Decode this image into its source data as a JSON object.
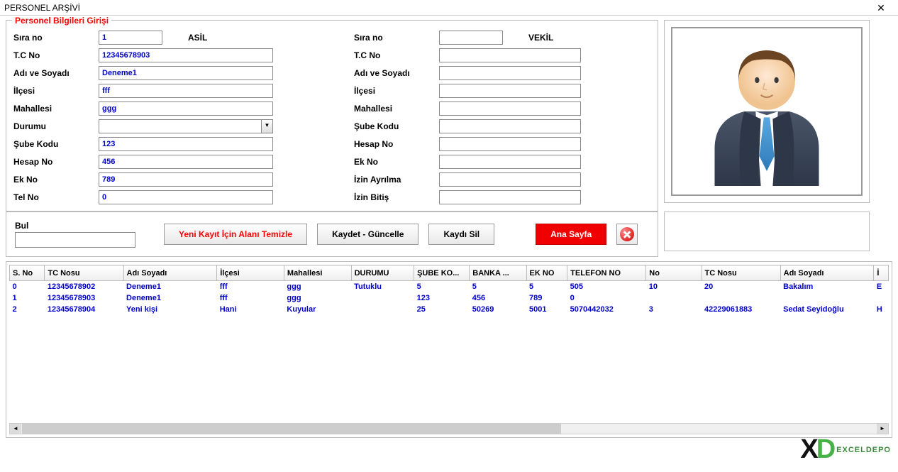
{
  "window": {
    "title": "PERSONEL ARŞİVİ"
  },
  "fieldset": {
    "legend": "Personel Bilgileri Girişi"
  },
  "asil": {
    "side_label": "ASİL",
    "labels": {
      "sira_no": "Sıra no",
      "tc_no": "T.C No",
      "adi_soyadi": "Adı ve Soyadı",
      "ilcesi": "İlçesi",
      "mahallesi": "Mahallesi",
      "durumu": "Durumu",
      "sube_kodu": "Şube Kodu",
      "hesap_no": "Hesap No",
      "ek_no": "Ek No",
      "tel_no": "Tel No"
    },
    "values": {
      "sira_no": "1",
      "tc_no": "12345678903",
      "adi_soyadi": "Deneme1",
      "ilcesi": "fff",
      "mahallesi": "ggg",
      "durumu": "",
      "sube_kodu": "123",
      "hesap_no": "456",
      "ek_no": "789",
      "tel_no": "0"
    }
  },
  "vekil": {
    "side_label": "VEKİL",
    "labels": {
      "sira_no": "Sıra no",
      "tc_no": "T.C No",
      "adi_soyadi": "Adı ve Soyadı",
      "ilcesi": "İlçesi",
      "mahallesi": "Mahallesi",
      "sube_kodu": "Şube Kodu",
      "hesap_no": "Hesap No",
      "ek_no": "Ek No",
      "izin_ayrilma": "İzin Ayrılma",
      "izin_bitis": "İzin Bitiş"
    }
  },
  "toolbar": {
    "bul_label": "Bul",
    "yeni_kayit": "Yeni Kayıt İçin Alanı Temizle",
    "kaydet": "Kaydet - Güncelle",
    "kaydi_sil": "Kaydı Sil",
    "ana_sayfa": "Ana Sayfa"
  },
  "grid": {
    "headers": [
      "S. No",
      "TC Nosu",
      "Adı Soyadı",
      "İlçesi",
      "Mahallesi",
      "DURUMU",
      "ŞUBE KO...",
      "BANKA ...",
      "EK NO",
      "TELEFON NO",
      "No",
      "TC Nosu",
      "Adı Soyadı",
      "İ"
    ],
    "rows": [
      [
        "0",
        "12345678902",
        "Deneme1",
        "fff",
        "ggg",
        "Tutuklu",
        "5",
        "5",
        "5",
        "505",
        "10",
        "20",
        "Bakalım",
        "E"
      ],
      [
        "1",
        "12345678903",
        "Deneme1",
        "fff",
        "ggg",
        "",
        "123",
        "456",
        "789",
        "0",
        "",
        "",
        "",
        ""
      ],
      [
        "2",
        "12345678904",
        "Yeni kişi",
        "Hani",
        "Kuyular",
        "",
        "25",
        "50269",
        "5001",
        "5070442032",
        "3",
        "42229061883",
        "Sedat Seyidoğlu",
        "H"
      ]
    ]
  },
  "watermark": {
    "brand_x": "X",
    "brand_d": "D",
    "text": "EXCELDEPO"
  }
}
